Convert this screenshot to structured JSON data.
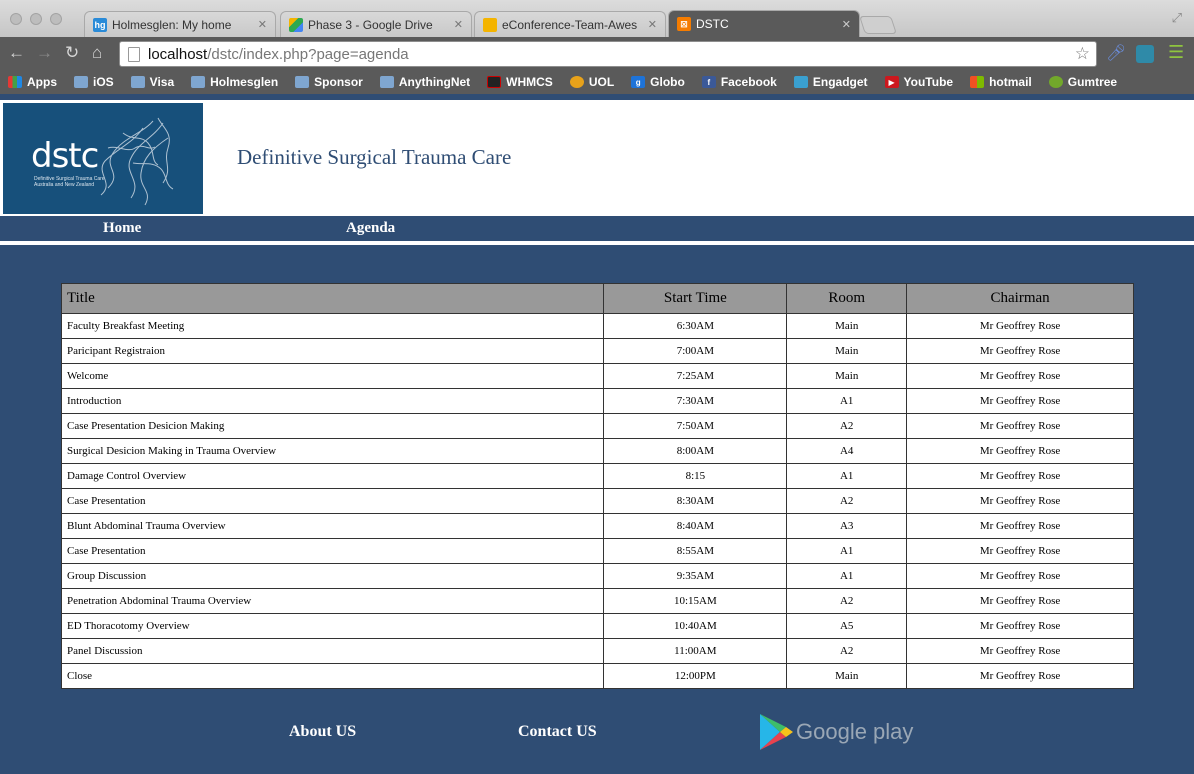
{
  "browser": {
    "tabs": [
      {
        "title": "Holmesglen: My home",
        "favicon": "hg",
        "favicon_color": "#2a8bd8",
        "active": false
      },
      {
        "title": "Phase 3 - Google Drive",
        "favicon": "drive",
        "favicon_color": "#2da94f",
        "active": false
      },
      {
        "title": "eConference-Team-Awes",
        "favicon": "slides",
        "favicon_color": "#f4b400",
        "active": false
      },
      {
        "title": "DSTC",
        "favicon": "xampp",
        "favicon_color": "#f57c00",
        "active": true
      }
    ],
    "url_host": "localhost",
    "url_path": "/dstc/index.php?page=agenda",
    "bookmarks": [
      {
        "label": "Apps",
        "icon": "apps-grid-icon"
      },
      {
        "label": "iOS",
        "icon": "folder-icon"
      },
      {
        "label": "Visa",
        "icon": "folder-icon"
      },
      {
        "label": "Holmesglen",
        "icon": "folder-icon"
      },
      {
        "label": "Sponsor",
        "icon": "folder-icon"
      },
      {
        "label": "AnythingNet",
        "icon": "folder-icon"
      },
      {
        "label": "WHMCS",
        "icon": "net-icon"
      },
      {
        "label": "UOL",
        "icon": "uol-icon"
      },
      {
        "label": "Globo",
        "icon": "globo-icon"
      },
      {
        "label": "Facebook",
        "icon": "facebook-icon"
      },
      {
        "label": "Engadget",
        "icon": "rss-icon"
      },
      {
        "label": "YouTube",
        "icon": "youtube-icon"
      },
      {
        "label": "hotmail",
        "icon": "windows-icon"
      },
      {
        "label": "Gumtree",
        "icon": "gumtree-icon"
      }
    ]
  },
  "site": {
    "logo_text": "dstc",
    "logo_sub": "Definitive Surgical Trauma Care Australia and New Zealand",
    "title": "Definitive Surgical Trauma Care",
    "nav": {
      "home": "Home",
      "agenda": "Agenda"
    }
  },
  "agenda": {
    "headers": {
      "title": "Title",
      "start_time": "Start Time",
      "room": "Room",
      "chairman": "Chairman"
    },
    "rows": [
      {
        "title": "Faculty Breakfast Meeting",
        "start_time": "6:30AM",
        "room": "Main",
        "chairman": "Mr Geoffrey Rose"
      },
      {
        "title": "Paricipant Registraion",
        "start_time": "7:00AM",
        "room": "Main",
        "chairman": "Mr Geoffrey Rose"
      },
      {
        "title": "Welcome",
        "start_time": "7:25AM",
        "room": "Main",
        "chairman": "Mr Geoffrey Rose"
      },
      {
        "title": "Introduction",
        "start_time": "7:30AM",
        "room": "A1",
        "chairman": "Mr Geoffrey Rose"
      },
      {
        "title": "Case Presentation Desicion Making",
        "start_time": "7:50AM",
        "room": "A2",
        "chairman": "Mr Geoffrey Rose"
      },
      {
        "title": "Surgical Desicion Making in Trauma Overview",
        "start_time": "8:00AM",
        "room": "A4",
        "chairman": "Mr Geoffrey Rose"
      },
      {
        "title": "Damage Control Overview",
        "start_time": "8:15",
        "room": "A1",
        "chairman": "Mr Geoffrey Rose"
      },
      {
        "title": "Case Presentation",
        "start_time": "8:30AM",
        "room": "A2",
        "chairman": "Mr Geoffrey Rose"
      },
      {
        "title": "Blunt Abdominal Trauma Overview",
        "start_time": "8:40AM",
        "room": "A3",
        "chairman": "Mr Geoffrey Rose"
      },
      {
        "title": "Case Presentation",
        "start_time": "8:55AM",
        "room": "A1",
        "chairman": "Mr Geoffrey Rose"
      },
      {
        "title": "Group Discussion",
        "start_time": "9:35AM",
        "room": "A1",
        "chairman": "Mr Geoffrey Rose"
      },
      {
        "title": "Penetration Abdominal Trauma Overview",
        "start_time": "10:15AM",
        "room": "A2",
        "chairman": "Mr Geoffrey Rose"
      },
      {
        "title": "ED Thoracotomy Overview",
        "start_time": "10:40AM",
        "room": "A5",
        "chairman": "Mr Geoffrey Rose"
      },
      {
        "title": "Panel Discussion",
        "start_time": "11:00AM",
        "room": "A2",
        "chairman": "Mr Geoffrey Rose"
      },
      {
        "title": "Close",
        "start_time": "12:00PM",
        "room": "Main",
        "chairman": "Mr Geoffrey Rose"
      }
    ]
  },
  "footer": {
    "about": "About US",
    "contact": "Contact US",
    "google_play": "Google play"
  },
  "colors": {
    "brand_blue": "#2f4d74",
    "logo_blue": "#17507b",
    "table_header": "#999999"
  }
}
